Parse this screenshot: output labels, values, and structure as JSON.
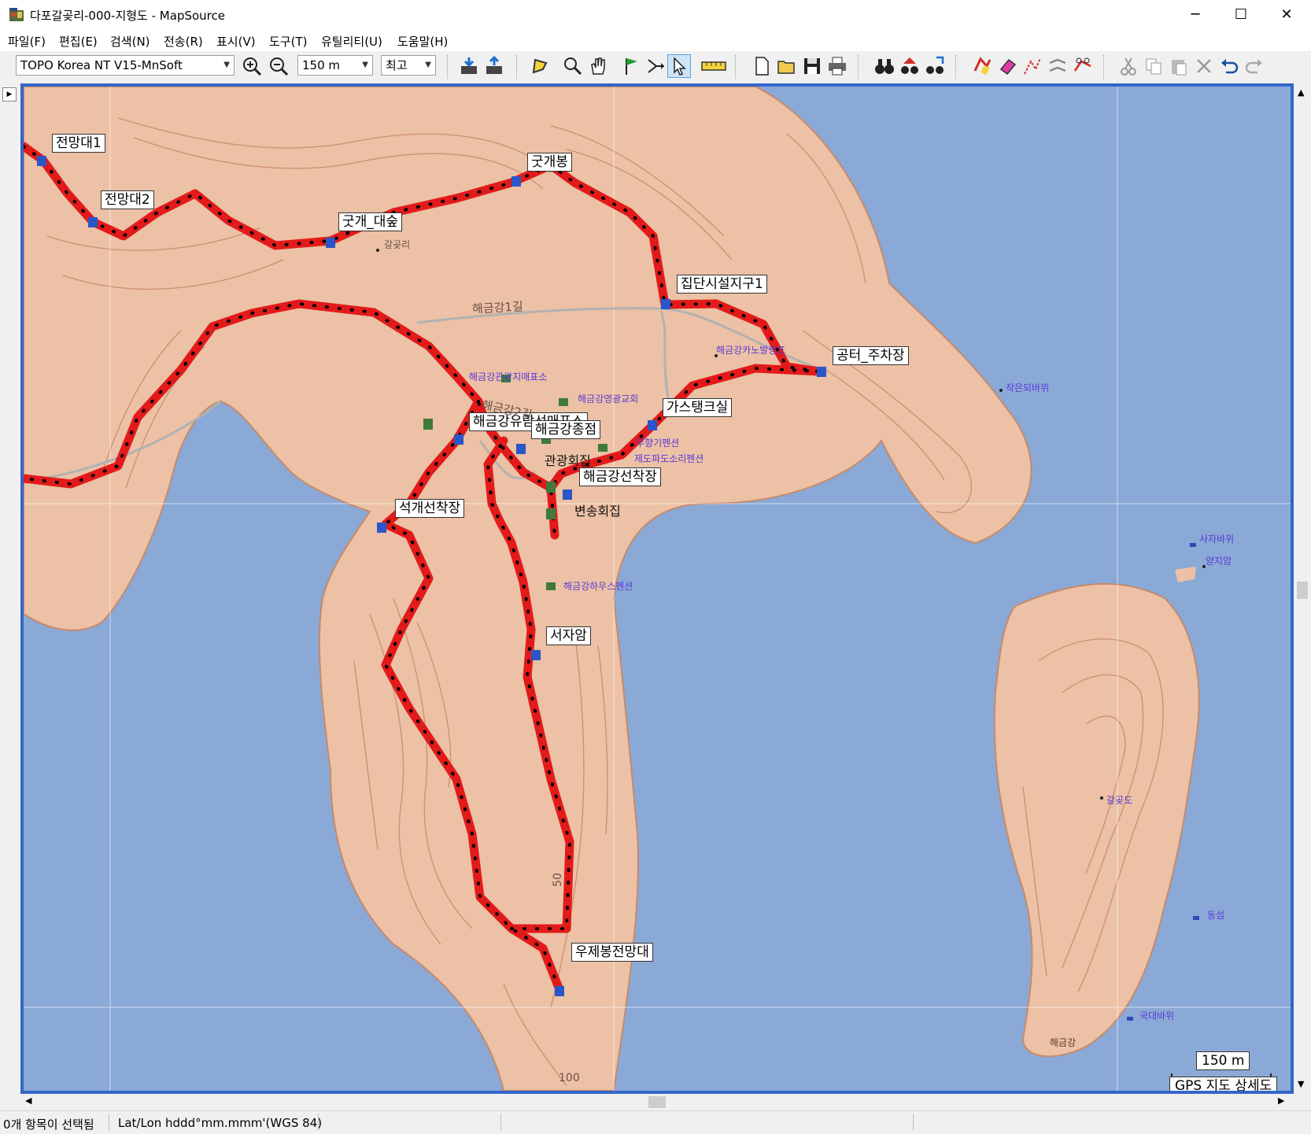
{
  "window": {
    "title": "다포갈곶리-000-지형도 - MapSource",
    "controls": {
      "minimize": "─",
      "maximize": "☐",
      "close": "✕"
    }
  },
  "menu": [
    "파일(F)",
    "편집(E)",
    "검색(N)",
    "전송(R)",
    "표시(V)",
    "도구(T)",
    "유틸리티(U)",
    "도움말(H)"
  ],
  "toolbar": {
    "map_product": "TOPO Korea NT V15-MnSoft",
    "zoom_scale": "150 m",
    "detail_level": "최고"
  },
  "map": {
    "waypoints": [
      "전망대1",
      "전망대2",
      "굿개봉",
      "굿개_대숲",
      "집단시설지구1",
      "공터_주차장",
      "가스탱크실",
      "해금강유람선매표소",
      "해금강종점",
      "해금강선착장",
      "석개선착장",
      "서자암",
      "우제봉전망대",
      "관광회집",
      "변송회집"
    ],
    "place_names": [
      "해금강1길",
      "해금강2길",
      "갈곶리"
    ],
    "pois": [
      "해금강관광지매표소",
      "해금강영광교회",
      "해금강카노발랑프",
      "무향기펜션",
      "제도파도소리펜션",
      "해금강하우스펜션",
      "작은되바위",
      "사자바위",
      "양지암",
      "갈곶도",
      "동섬",
      "국대바위",
      "해금강"
    ],
    "contour_labels": [
      "50",
      "100"
    ],
    "scale_label": "150 m",
    "map_type": "GPS 지도 상세도"
  },
  "status": {
    "selection": "0개 항목이 선택됨",
    "coord_format": "Lat/Lon hddd°mm.mmm'(WGS 84)"
  }
}
